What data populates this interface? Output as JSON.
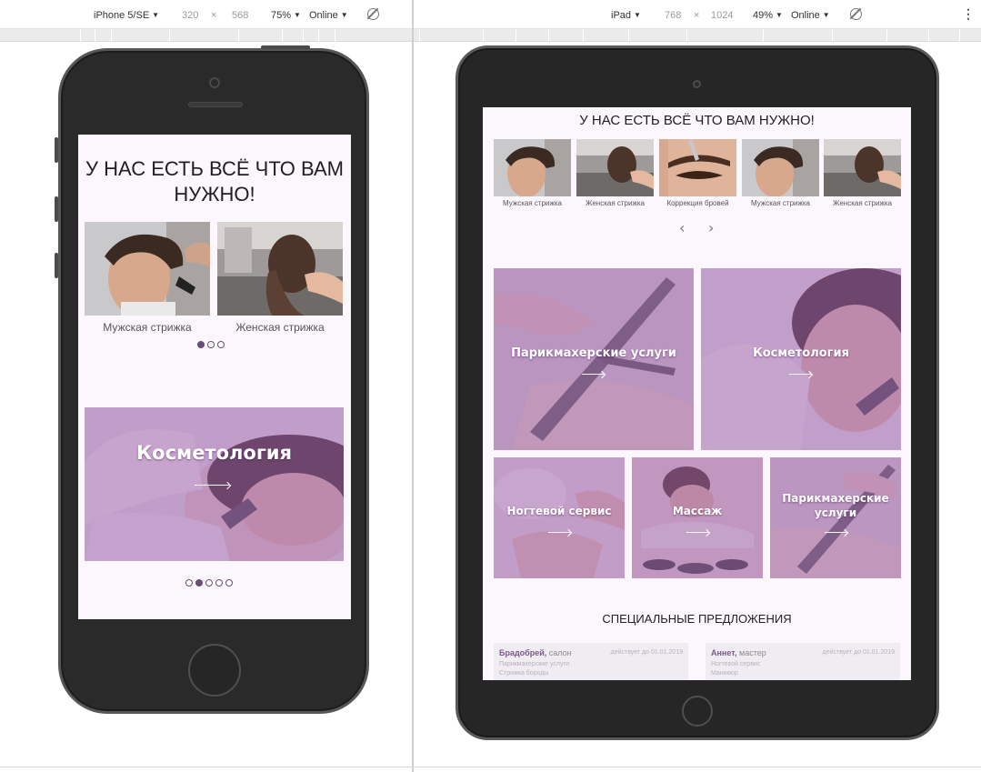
{
  "devtools": {
    "left": {
      "device": "iPhone 5/SE",
      "width": "320",
      "x": "×",
      "height": "568",
      "zoom": "75%",
      "network": "Online"
    },
    "right": {
      "device": "iPad",
      "width": "768",
      "x": "×",
      "height": "1024",
      "zoom": "49%",
      "network": "Online"
    }
  },
  "site": {
    "heading": "У НАС ЕСТЬ ВСЁ ЧТО ВАМ НУЖНО!",
    "phone": {
      "services": [
        "Мужская стрижка",
        "Женская стрижка"
      ],
      "dots_top": [
        true,
        false,
        false
      ],
      "category": "Косметология",
      "dots_bottom": [
        false,
        true,
        false,
        false,
        false
      ]
    },
    "tablet": {
      "services": [
        "Мужская стрижка",
        "Женская стрижка",
        "Коррекция бровей",
        "Мужская стрижка",
        "Женская стрижка"
      ],
      "prev": "‹",
      "next": "›",
      "categories": [
        "Парикмахерские услуги",
        "Косметология",
        "Ногтевой сервис",
        "Массаж",
        "Парикмахерские услуги"
      ],
      "special_title": "СПЕЦИАЛЬНЫЕ ПРЕДЛОЖЕНИЯ",
      "offers": [
        {
          "name": "Брадобрей,",
          "role": " салон",
          "valid": "действует до 01.01.2019",
          "line1": "Парикмахерские услуги",
          "line2": "Стрижка бороды"
        },
        {
          "name": "Аннет,",
          "role": " мастер",
          "valid": "действует до 01.01.2019",
          "line1": "Ногтевой сервис",
          "line2": "Маникюр"
        }
      ]
    }
  },
  "colors": {
    "accent": "#6a4c7a",
    "overlay": "#a064af",
    "page_bg": "#fbf7fd",
    "device_frame": "#2a2a2a"
  }
}
